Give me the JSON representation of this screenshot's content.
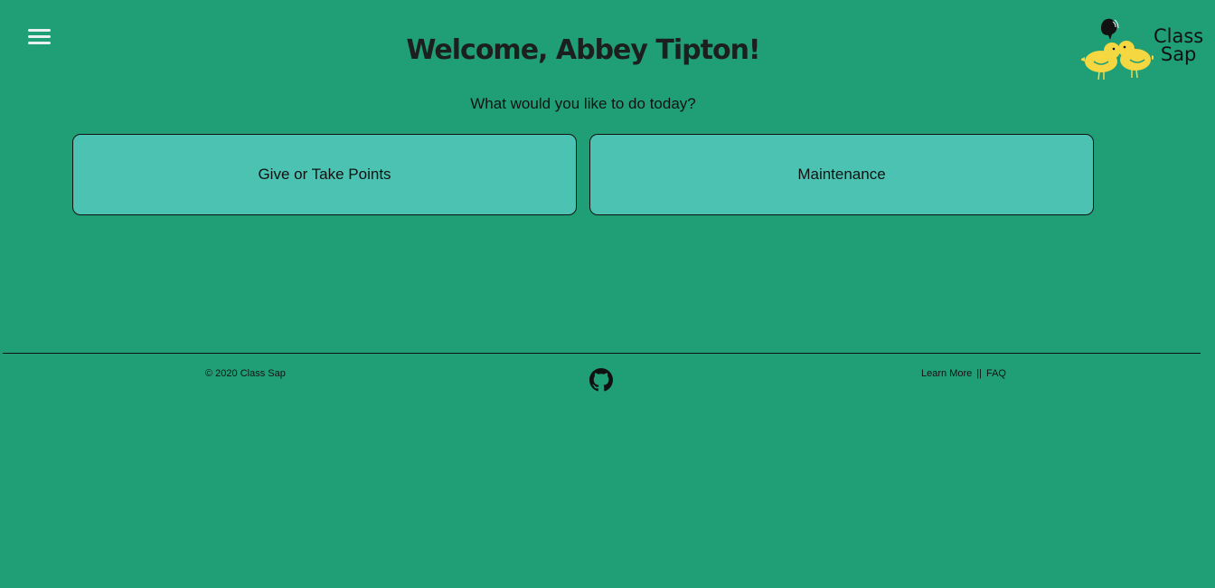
{
  "header": {
    "menu_icon": "hamburger-menu-icon",
    "title": "Welcome, Abbey Tipton!",
    "subtitle": "What would you like to do today?",
    "logo": {
      "line1": "Class",
      "line2": "Sap",
      "icon": "two-yellow-birds-icon"
    }
  },
  "actions": [
    {
      "label": "Give or Take Points"
    },
    {
      "label": "Maintenance"
    }
  ],
  "footer": {
    "copyright": "© 2020 Class Sap",
    "github_icon": "github-icon",
    "learn_more": "Learn More",
    "separator": "||",
    "faq": "FAQ"
  },
  "colors": {
    "background": "#209f76",
    "button": "#4cc3b2",
    "bird": "#f5d742"
  }
}
